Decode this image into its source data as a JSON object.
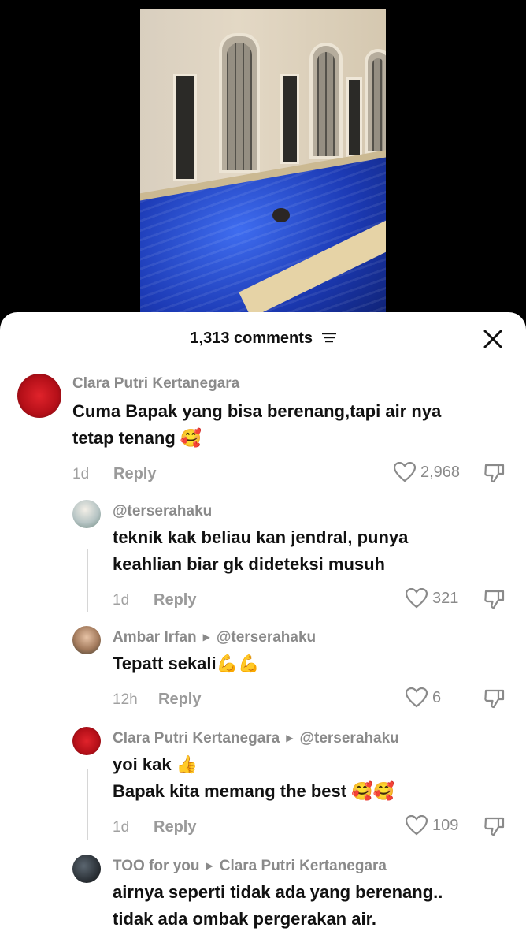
{
  "header": {
    "comment_count": "1,313 comments"
  },
  "comments": [
    {
      "username": "Clara Putri Kertanegara",
      "line1": "Cuma Bapak yang bisa berenang,tapi air nya",
      "line2": "tetap tenang",
      "emoji": "🥰",
      "time": "1d",
      "reply_label": "Reply",
      "likes": "2,968",
      "avatar_color": "#c4141c"
    },
    {
      "username": "@terserahaku",
      "line1": "teknik kak beliau kan jendral, punya",
      "line2": "keahlian biar gk dideteksi musuh",
      "time": "1d",
      "reply_label": "Reply",
      "likes": "321",
      "avatar_color": "#b9c7c9"
    },
    {
      "username": "Ambar Irfan",
      "reply_to": "@terserahaku",
      "line1": "Tepatt sekali",
      "emoji": "💪💪",
      "time": "12h",
      "reply_label": "Reply",
      "likes": "6",
      "avatar_color": "#a37a5c"
    },
    {
      "username": "Clara Putri Kertanegara",
      "reply_to": "@terserahaku",
      "line1": "yoi kak",
      "emoji1": "👍",
      "line2": "Bapak kita memang the best",
      "emoji2": "🥰🥰",
      "time": "1d",
      "reply_label": "Reply",
      "likes": "109",
      "avatar_color": "#c4141c"
    },
    {
      "username": "TOO for you",
      "reply_to": "Clara Putri Kertanegara",
      "line1": "airnya seperti tidak ada yang berenang..",
      "line2": "tidak ada ombak pergerakan air.",
      "avatar_color": "#2c3238"
    }
  ]
}
